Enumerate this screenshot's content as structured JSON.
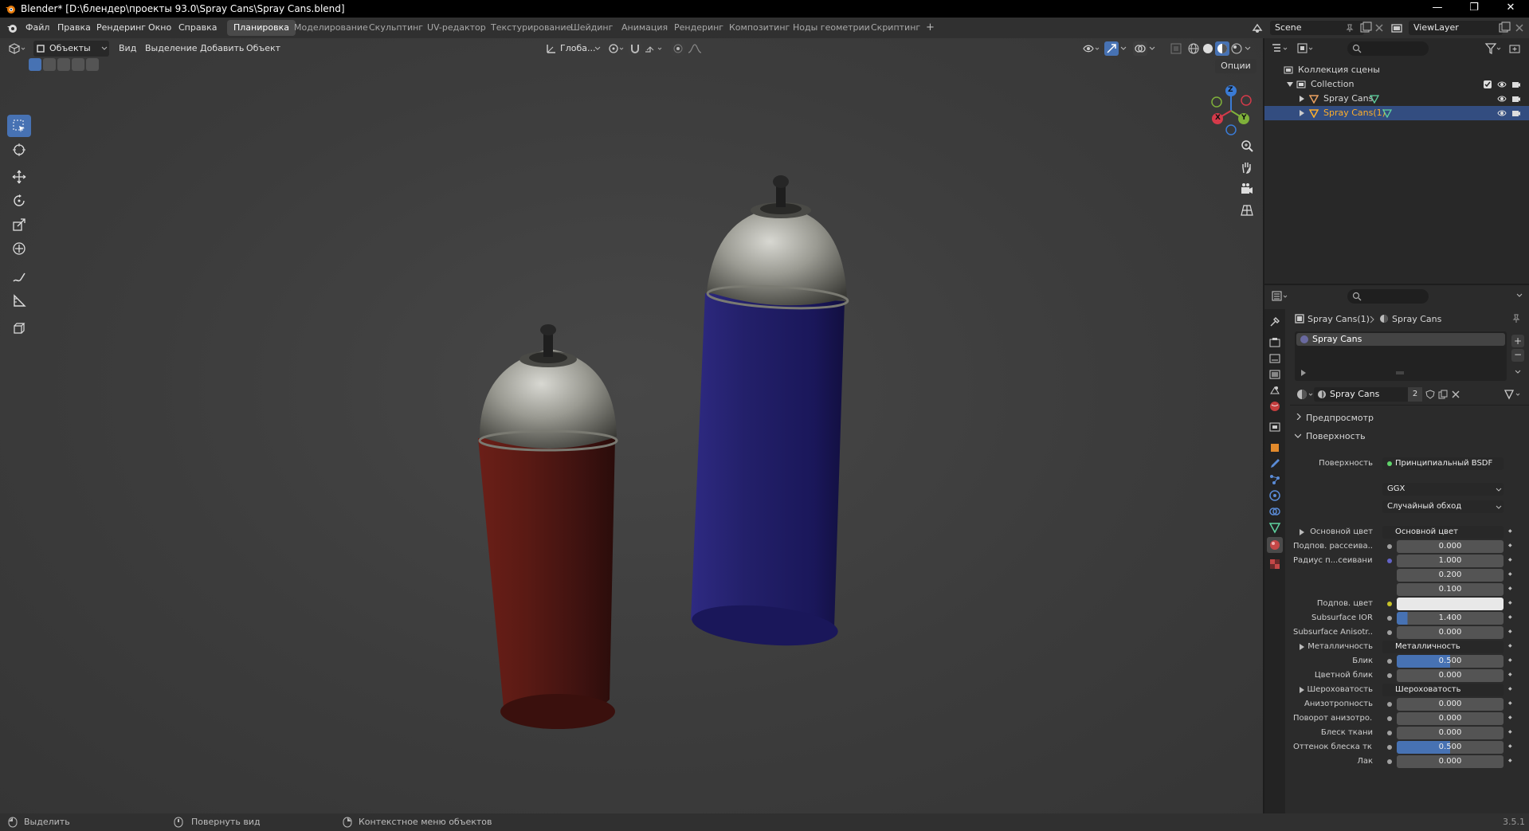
{
  "window": {
    "title": "Blender* [D:\\блендер\\проекты 93.0\\Spray Cans\\Spray Cans.blend]",
    "minimize": "—",
    "maximize": "❐",
    "close": "✕"
  },
  "topbar": {
    "menu": [
      "Файл",
      "Правка",
      "Рендеринг",
      "Окно",
      "Справка"
    ],
    "workspaces": [
      "Планировка",
      "Моделирование",
      "Скульптинг",
      "UV-редактор",
      "Текстурирование",
      "Шейдинг",
      "Анимация",
      "Рендеринг",
      "Композитинг",
      "Ноды геометрии",
      "Скриптинг"
    ],
    "add_tab": "+",
    "scene": "Scene",
    "view_layer": "ViewLayer"
  },
  "viewport_header": {
    "mode": "Объекты",
    "menus": [
      "Вид",
      "Выделение",
      "Добавить",
      "Объект"
    ],
    "transform": "Глоба...",
    "options": "Опции"
  },
  "gizmo": {
    "x": "X",
    "y": "Y",
    "z": "Z"
  },
  "outliner": {
    "root": "Коллекция сцены",
    "collection": "Collection",
    "objects": [
      {
        "name": "Spray Cans",
        "selected": false
      },
      {
        "name": "Spray Cans(1)",
        "selected": true
      }
    ]
  },
  "properties": {
    "breadcrumb_object": "Spray Cans(1)",
    "breadcrumb_material": "Spray Cans",
    "slot": "Spray Cans",
    "material_name": "Spray Cans",
    "users": "2",
    "panels": {
      "preview": "Предпросмотр",
      "surface": "Поверхность"
    },
    "surface_label": "Поверхность",
    "surface_value": "Принципиальный BSDF",
    "distribution": "GGX",
    "subsurface_method": "Случайный обход",
    "rows": [
      {
        "label": "Основной цвет",
        "value": "Основной цвет",
        "kind": "link",
        "dot": "#c7c229",
        "expand": true
      },
      {
        "label": "Подпов. рассеива...",
        "value": "0.000",
        "kind": "num",
        "dot": "#a1a1a1"
      },
      {
        "label": "Радиус п...сеивания",
        "value": "1.000",
        "kind": "num",
        "dot": "#6363c7"
      },
      {
        "label": "",
        "value": "0.200",
        "kind": "num"
      },
      {
        "label": "",
        "value": "0.100",
        "kind": "num"
      },
      {
        "label": "Подпов. цвет",
        "value": "",
        "kind": "color",
        "dot": "#c7c229"
      },
      {
        "label": "Subsurface IOR",
        "value": "1.400",
        "kind": "num",
        "dot": "#a1a1a1",
        "bar": 0.1
      },
      {
        "label": "Subsurface Anisotr...",
        "value": "0.000",
        "kind": "num",
        "dot": "#a1a1a1"
      },
      {
        "label": "Металличность",
        "value": "Металличность",
        "kind": "link",
        "dot": "#a1a1a1",
        "expand": true
      },
      {
        "label": "Блик",
        "value": "0.500",
        "kind": "num",
        "dot": "#a1a1a1",
        "bar": 0.5
      },
      {
        "label": "Цветной блик",
        "value": "0.000",
        "kind": "num",
        "dot": "#a1a1a1"
      },
      {
        "label": "Шероховатость",
        "value": "Шероховатость",
        "kind": "link",
        "dot": "#a1a1a1",
        "expand": true
      },
      {
        "label": "Анизотропность",
        "value": "0.000",
        "kind": "num",
        "dot": "#a1a1a1"
      },
      {
        "label": "Поворот анизотро...",
        "value": "0.000",
        "kind": "num",
        "dot": "#a1a1a1"
      },
      {
        "label": "Блеск ткани",
        "value": "0.000",
        "kind": "num",
        "dot": "#a1a1a1"
      },
      {
        "label": "Оттенок блеска тк...",
        "value": "0.500",
        "kind": "num",
        "dot": "#a1a1a1",
        "bar": 0.5
      },
      {
        "label": "Лак",
        "value": "0.000",
        "kind": "num",
        "dot": "#a1a1a1"
      }
    ]
  },
  "statusbar": {
    "select": "Выделить",
    "rotate": "Повернуть вид",
    "context": "Контекстное меню объектов",
    "version": "3.5.1"
  },
  "colors": {
    "accent": "#4772b3",
    "selected_row": "#334d80",
    "can_red": "#5a1a14",
    "can_blue": "#23206a"
  }
}
